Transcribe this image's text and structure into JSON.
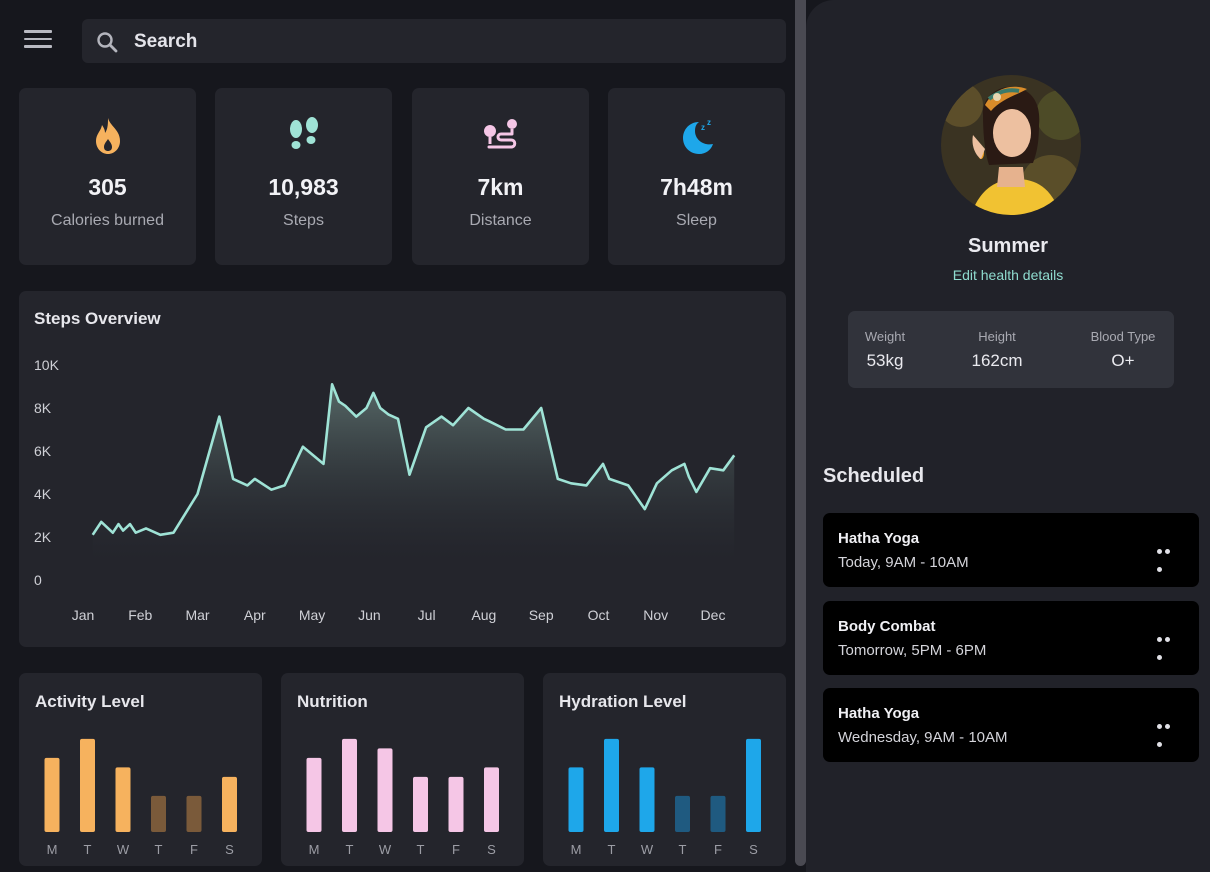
{
  "search": {
    "placeholder": "Search",
    "value": ""
  },
  "stats": [
    {
      "icon": "flame-icon",
      "value": "305",
      "label": "Calories burned",
      "color": "#f6b25e"
    },
    {
      "icon": "footsteps-icon",
      "value": "10,983",
      "label": "Steps",
      "color": "#9fe3d6"
    },
    {
      "icon": "distance-icon",
      "value": "7km",
      "label": "Distance",
      "color": "#f5c6e6"
    },
    {
      "icon": "moon-icon",
      "value": "7h48m",
      "label": "Sleep",
      "color": "#1ea7ea"
    }
  ],
  "steps_overview": {
    "title": "Steps Overview",
    "chart_data": {
      "type": "area",
      "title": "Steps Overview",
      "ylim": [
        0,
        10000
      ],
      "y_ticks": [
        "10K",
        "8K",
        "6K",
        "4K",
        "2K",
        "0"
      ],
      "x_ticks": [
        "Jan",
        "Feb",
        "Mar",
        "Apr",
        "May",
        "Jun",
        "Jul",
        "Aug",
        "Sep",
        "Oct",
        "Nov",
        "Dec"
      ],
      "grid": false,
      "color": "#9fe3d6",
      "x": [
        0.17,
        0.32,
        0.52,
        0.62,
        0.7,
        0.82,
        0.92,
        1.1,
        1.35,
        1.58,
        2.0,
        2.38,
        2.62,
        2.87,
        3.0,
        3.29,
        3.52,
        3.84,
        4.2,
        4.35,
        4.47,
        4.58,
        4.77,
        4.95,
        5.07,
        5.19,
        5.33,
        5.5,
        5.7,
        5.99,
        6.26,
        6.46,
        6.73,
        7.0,
        7.08,
        7.38,
        7.69,
        8.0,
        8.29,
        8.52,
        8.79,
        9.08,
        9.19,
        9.52,
        9.81,
        10.02,
        10.28,
        10.5,
        10.58,
        10.71,
        10.95,
        11.18,
        11.37
      ],
      "y": [
        2100,
        2700,
        2200,
        2600,
        2300,
        2600,
        2200,
        2400,
        2100,
        2200,
        4000,
        7600,
        4700,
        4400,
        4700,
        4200,
        4400,
        6200,
        5400,
        9100,
        8300,
        8100,
        7600,
        8000,
        8700,
        8000,
        7700,
        7500,
        4900,
        7100,
        7600,
        7200,
        8000,
        7500,
        7400,
        7000,
        7000,
        8000,
        4700,
        4500,
        4400,
        5400,
        4700,
        4400,
        3300,
        4500,
        5100,
        5400,
        4800,
        4100,
        5200,
        5100,
        5800
      ]
    }
  },
  "activity": {
    "title": "Activity Level",
    "chart_data": {
      "type": "bar",
      "categories": [
        "M",
        "T",
        "W",
        "T",
        "F",
        "S"
      ],
      "values": [
        78,
        98,
        68,
        38,
        38,
        58
      ],
      "ylim": [
        0,
        100
      ],
      "colors": [
        "#f6b25e",
        "#f6b25e",
        "#f6b25e",
        "#7a5a3a",
        "#7a5a3a",
        "#f6b25e"
      ]
    }
  },
  "nutrition": {
    "title": "Nutrition",
    "chart_data": {
      "type": "bar",
      "categories": [
        "M",
        "T",
        "W",
        "T",
        "F",
        "S"
      ],
      "values": [
        78,
        98,
        88,
        58,
        58,
        68
      ],
      "ylim": [
        0,
        100
      ],
      "colors": [
        "#f5c6e6",
        "#f5c6e6",
        "#f5c6e6",
        "#f5c6e6",
        "#f5c6e6",
        "#f5c6e6"
      ]
    }
  },
  "hydration": {
    "title": "Hydration Level",
    "chart_data": {
      "type": "bar",
      "categories": [
        "M",
        "T",
        "W",
        "T",
        "F",
        "S"
      ],
      "values": [
        68,
        98,
        68,
        38,
        38,
        98
      ],
      "ylim": [
        0,
        100
      ],
      "colors": [
        "#1ea7ea",
        "#1ea7ea",
        "#1ea7ea",
        "#1f5a80",
        "#1f5a80",
        "#1ea7ea"
      ]
    }
  },
  "profile": {
    "name": "Summer",
    "edit_link": "Edit health details",
    "health": [
      {
        "label": "Weight",
        "value": "53kg"
      },
      {
        "label": "Height",
        "value": "162cm"
      },
      {
        "label": "Blood Type",
        "value": "O+"
      }
    ]
  },
  "scheduled": {
    "title": "Scheduled",
    "items": [
      {
        "title": "Hatha Yoga",
        "when": "Today, 9AM - 10AM"
      },
      {
        "title": "Body Combat",
        "when": "Tomorrow, 5PM - 6PM"
      },
      {
        "title": "Hatha Yoga",
        "when": "Wednesday, 9AM - 10AM"
      }
    ]
  }
}
